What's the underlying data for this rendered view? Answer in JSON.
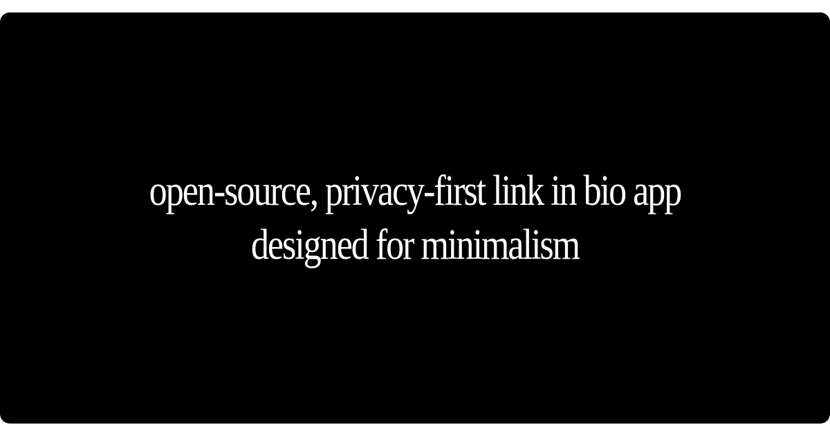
{
  "tagline": {
    "line1": "open-source, privacy-first link in bio app",
    "line2": "designed for minimalism"
  },
  "colors": {
    "background": "#000000",
    "text": "#ffffff",
    "frame": "#ffffff"
  }
}
